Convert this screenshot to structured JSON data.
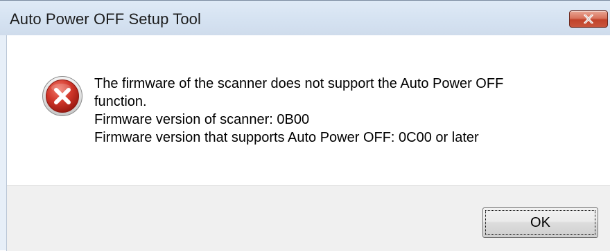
{
  "window": {
    "title": "Auto Power OFF Setup Tool",
    "close_icon": "close-icon"
  },
  "dialog": {
    "icon": "error-icon",
    "message_lines": [
      "The firmware of the scanner does not support the Auto Power OFF",
      "function.",
      "Firmware version of scanner: 0B00",
      "Firmware version that supports Auto Power OFF: 0C00 or later"
    ]
  },
  "buttons": {
    "ok_label": "OK"
  },
  "colors": {
    "titlebar": "#d6e3f2",
    "close_button": "#c9553c",
    "error_icon": "#c42b1c",
    "button_area": "#f0f0f0"
  }
}
